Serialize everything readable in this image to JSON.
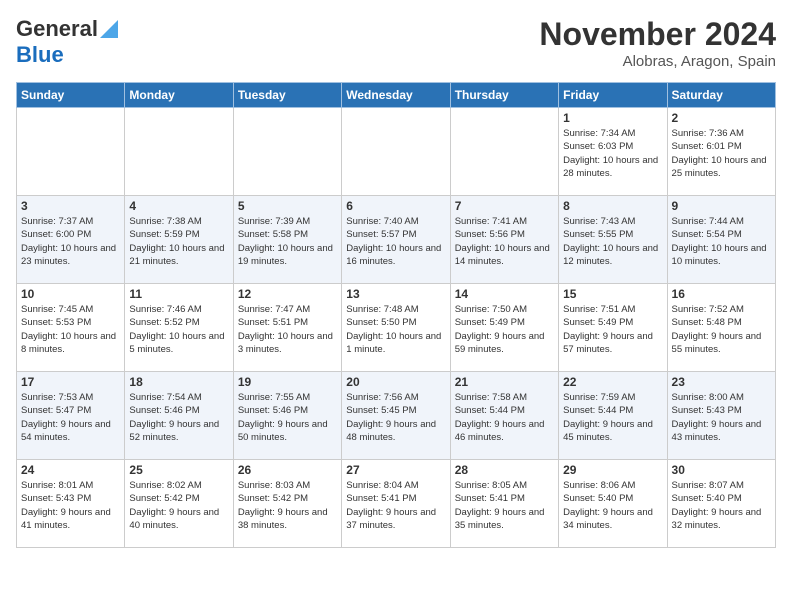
{
  "header": {
    "logo": {
      "general": "General",
      "blue": "Blue"
    },
    "title": "November 2024",
    "location": "Alobras, Aragon, Spain"
  },
  "weekdays": [
    "Sunday",
    "Monday",
    "Tuesday",
    "Wednesday",
    "Thursday",
    "Friday",
    "Saturday"
  ],
  "weeks": [
    [
      {
        "day": "",
        "content": ""
      },
      {
        "day": "",
        "content": ""
      },
      {
        "day": "",
        "content": ""
      },
      {
        "day": "",
        "content": ""
      },
      {
        "day": "",
        "content": ""
      },
      {
        "day": "1",
        "content": "Sunrise: 7:34 AM\nSunset: 6:03 PM\nDaylight: 10 hours and 28 minutes."
      },
      {
        "day": "2",
        "content": "Sunrise: 7:36 AM\nSunset: 6:01 PM\nDaylight: 10 hours and 25 minutes."
      }
    ],
    [
      {
        "day": "3",
        "content": "Sunrise: 7:37 AM\nSunset: 6:00 PM\nDaylight: 10 hours and 23 minutes."
      },
      {
        "day": "4",
        "content": "Sunrise: 7:38 AM\nSunset: 5:59 PM\nDaylight: 10 hours and 21 minutes."
      },
      {
        "day": "5",
        "content": "Sunrise: 7:39 AM\nSunset: 5:58 PM\nDaylight: 10 hours and 19 minutes."
      },
      {
        "day": "6",
        "content": "Sunrise: 7:40 AM\nSunset: 5:57 PM\nDaylight: 10 hours and 16 minutes."
      },
      {
        "day": "7",
        "content": "Sunrise: 7:41 AM\nSunset: 5:56 PM\nDaylight: 10 hours and 14 minutes."
      },
      {
        "day": "8",
        "content": "Sunrise: 7:43 AM\nSunset: 5:55 PM\nDaylight: 10 hours and 12 minutes."
      },
      {
        "day": "9",
        "content": "Sunrise: 7:44 AM\nSunset: 5:54 PM\nDaylight: 10 hours and 10 minutes."
      }
    ],
    [
      {
        "day": "10",
        "content": "Sunrise: 7:45 AM\nSunset: 5:53 PM\nDaylight: 10 hours and 8 minutes."
      },
      {
        "day": "11",
        "content": "Sunrise: 7:46 AM\nSunset: 5:52 PM\nDaylight: 10 hours and 5 minutes."
      },
      {
        "day": "12",
        "content": "Sunrise: 7:47 AM\nSunset: 5:51 PM\nDaylight: 10 hours and 3 minutes."
      },
      {
        "day": "13",
        "content": "Sunrise: 7:48 AM\nSunset: 5:50 PM\nDaylight: 10 hours and 1 minute."
      },
      {
        "day": "14",
        "content": "Sunrise: 7:50 AM\nSunset: 5:49 PM\nDaylight: 9 hours and 59 minutes."
      },
      {
        "day": "15",
        "content": "Sunrise: 7:51 AM\nSunset: 5:49 PM\nDaylight: 9 hours and 57 minutes."
      },
      {
        "day": "16",
        "content": "Sunrise: 7:52 AM\nSunset: 5:48 PM\nDaylight: 9 hours and 55 minutes."
      }
    ],
    [
      {
        "day": "17",
        "content": "Sunrise: 7:53 AM\nSunset: 5:47 PM\nDaylight: 9 hours and 54 minutes."
      },
      {
        "day": "18",
        "content": "Sunrise: 7:54 AM\nSunset: 5:46 PM\nDaylight: 9 hours and 52 minutes."
      },
      {
        "day": "19",
        "content": "Sunrise: 7:55 AM\nSunset: 5:46 PM\nDaylight: 9 hours and 50 minutes."
      },
      {
        "day": "20",
        "content": "Sunrise: 7:56 AM\nSunset: 5:45 PM\nDaylight: 9 hours and 48 minutes."
      },
      {
        "day": "21",
        "content": "Sunrise: 7:58 AM\nSunset: 5:44 PM\nDaylight: 9 hours and 46 minutes."
      },
      {
        "day": "22",
        "content": "Sunrise: 7:59 AM\nSunset: 5:44 PM\nDaylight: 9 hours and 45 minutes."
      },
      {
        "day": "23",
        "content": "Sunrise: 8:00 AM\nSunset: 5:43 PM\nDaylight: 9 hours and 43 minutes."
      }
    ],
    [
      {
        "day": "24",
        "content": "Sunrise: 8:01 AM\nSunset: 5:43 PM\nDaylight: 9 hours and 41 minutes."
      },
      {
        "day": "25",
        "content": "Sunrise: 8:02 AM\nSunset: 5:42 PM\nDaylight: 9 hours and 40 minutes."
      },
      {
        "day": "26",
        "content": "Sunrise: 8:03 AM\nSunset: 5:42 PM\nDaylight: 9 hours and 38 minutes."
      },
      {
        "day": "27",
        "content": "Sunrise: 8:04 AM\nSunset: 5:41 PM\nDaylight: 9 hours and 37 minutes."
      },
      {
        "day": "28",
        "content": "Sunrise: 8:05 AM\nSunset: 5:41 PM\nDaylight: 9 hours and 35 minutes."
      },
      {
        "day": "29",
        "content": "Sunrise: 8:06 AM\nSunset: 5:40 PM\nDaylight: 9 hours and 34 minutes."
      },
      {
        "day": "30",
        "content": "Sunrise: 8:07 AM\nSunset: 5:40 PM\nDaylight: 9 hours and 32 minutes."
      }
    ]
  ]
}
